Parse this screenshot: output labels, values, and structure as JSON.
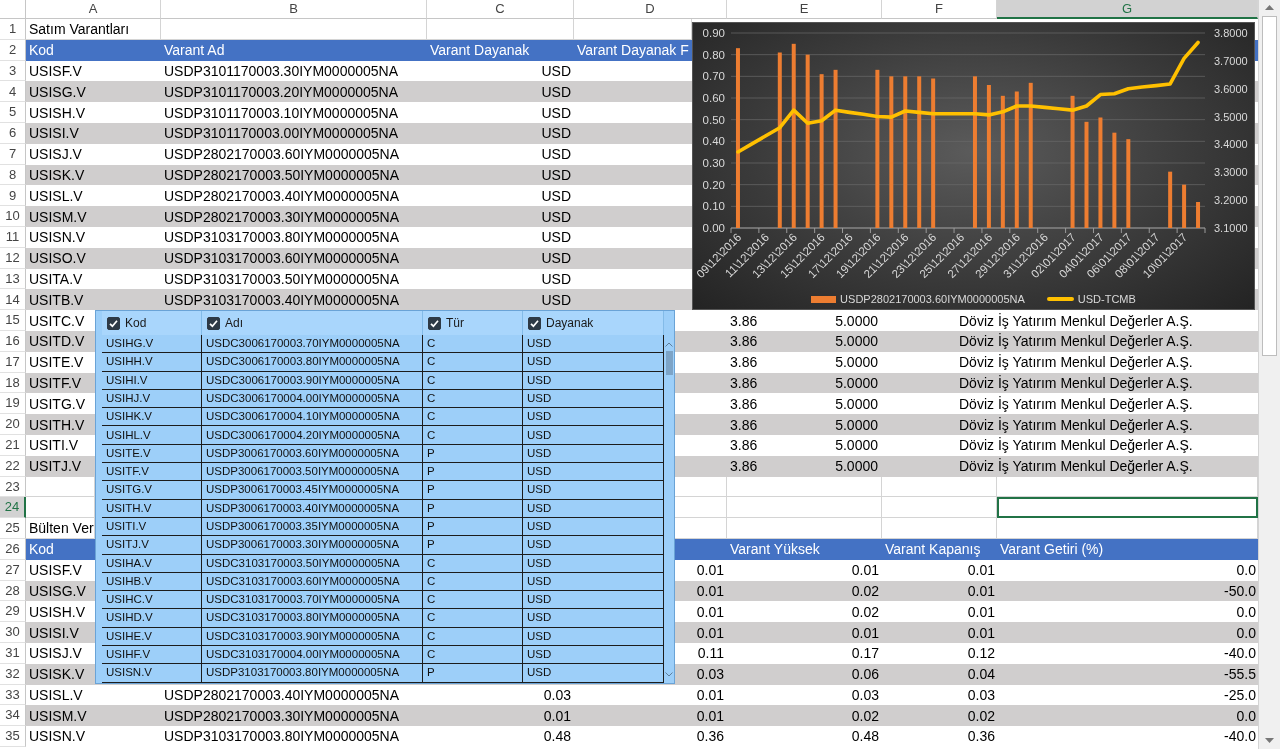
{
  "column_headers": [
    {
      "label": "A",
      "selected": false
    },
    {
      "label": "B",
      "selected": false
    },
    {
      "label": "C",
      "selected": false
    },
    {
      "label": "D",
      "selected": false
    },
    {
      "label": "E",
      "selected": false
    },
    {
      "label": "F",
      "selected": false
    },
    {
      "label": "G",
      "selected": true
    }
  ],
  "row_headers": [
    {
      "label": "1",
      "selected": false
    },
    {
      "label": "2",
      "selected": false
    },
    {
      "label": "3",
      "selected": false
    },
    {
      "label": "4",
      "selected": false
    },
    {
      "label": "5",
      "selected": false
    },
    {
      "label": "6",
      "selected": false
    },
    {
      "label": "7",
      "selected": false
    },
    {
      "label": "8",
      "selected": false
    },
    {
      "label": "9",
      "selected": false
    },
    {
      "label": "10",
      "selected": false
    },
    {
      "label": "11",
      "selected": false
    },
    {
      "label": "12",
      "selected": false
    },
    {
      "label": "13",
      "selected": false
    },
    {
      "label": "14",
      "selected": false
    },
    {
      "label": "15",
      "selected": false
    },
    {
      "label": "16",
      "selected": false
    },
    {
      "label": "17",
      "selected": false
    },
    {
      "label": "18",
      "selected": false
    },
    {
      "label": "19",
      "selected": false
    },
    {
      "label": "20",
      "selected": false
    },
    {
      "label": "21",
      "selected": false
    },
    {
      "label": "22",
      "selected": false
    },
    {
      "label": "23",
      "selected": false
    },
    {
      "label": "24",
      "selected": true
    },
    {
      "label": "25",
      "selected": false
    },
    {
      "label": "26",
      "selected": false
    },
    {
      "label": "27",
      "selected": false
    },
    {
      "label": "28",
      "selected": false
    },
    {
      "label": "29",
      "selected": false
    },
    {
      "label": "30",
      "selected": false
    },
    {
      "label": "31",
      "selected": false
    },
    {
      "label": "32",
      "selected": false
    },
    {
      "label": "33",
      "selected": false
    },
    {
      "label": "34",
      "selected": false
    },
    {
      "label": "35",
      "selected": false
    }
  ],
  "warrants": {
    "title": "Satım Varantları",
    "columns": {
      "kod": "Kod",
      "varant_ad": "Varant Ad",
      "varant_dayanak": "Varant Dayanak",
      "column_4": "Varant Dayanak F"
    },
    "rows": [
      {
        "kod": "USISF.V",
        "varant_ad": "USDP3101170003.30IYM0000005NA",
        "varant_dayanak": "USD"
      },
      {
        "kod": "USISG.V",
        "varant_ad": "USDP3101170003.20IYM0000005NA",
        "varant_dayanak": "USD"
      },
      {
        "kod": "USISH.V",
        "varant_ad": "USDP3101170003.10IYM0000005NA",
        "varant_dayanak": "USD"
      },
      {
        "kod": "USISI.V",
        "varant_ad": "USDP3101170003.00IYM0000005NA",
        "varant_dayanak": "USD"
      },
      {
        "kod": "USISJ.V",
        "varant_ad": "USDP2802170003.60IYM0000005NA",
        "varant_dayanak": "USD"
      },
      {
        "kod": "USISK.V",
        "varant_ad": "USDP2802170003.50IYM0000005NA",
        "varant_dayanak": "USD"
      },
      {
        "kod": "USISL.V",
        "varant_ad": "USDP2802170003.40IYM0000005NA",
        "varant_dayanak": "USD"
      },
      {
        "kod": "USISM.V",
        "varant_ad": "USDP2802170003.30IYM0000005NA",
        "varant_dayanak": "USD"
      },
      {
        "kod": "USISN.V",
        "varant_ad": "USDP3103170003.80IYM0000005NA",
        "varant_dayanak": "USD"
      },
      {
        "kod": "USISO.V",
        "varant_ad": "USDP3103170003.60IYM0000005NA",
        "varant_dayanak": "USD"
      },
      {
        "kod": "USITA.V",
        "varant_ad": "USDP3103170003.50IYM0000005NA",
        "varant_dayanak": "USD"
      },
      {
        "kod": "USITB.V",
        "varant_ad": "USDP3103170003.40IYM0000005NA",
        "varant_dayanak": "USD"
      },
      {
        "kod": "USITC.V",
        "column_5": "3.86",
        "column_6": "5.0000",
        "column_7": "Döviz İş Yatırım Menkul Değerler A.Ş."
      },
      {
        "kod": "USITD.V",
        "column_5": "3.86",
        "column_6": "5.0000",
        "column_7": "Döviz İş Yatırım Menkul Değerler A.Ş."
      },
      {
        "kod": "USITE.V",
        "column_5": "3.86",
        "column_6": "5.0000",
        "column_7": "Döviz İş Yatırım Menkul Değerler A.Ş."
      },
      {
        "kod": "USITF.V",
        "column_5": "3.86",
        "column_6": "5.0000",
        "column_7": "Döviz İş Yatırım Menkul Değerler A.Ş."
      },
      {
        "kod": "USITG.V",
        "column_5": "3.86",
        "column_6": "5.0000",
        "column_7": "Döviz İş Yatırım Menkul Değerler A.Ş."
      },
      {
        "kod": "USITH.V",
        "column_5": "3.86",
        "column_6": "5.0000",
        "column_7": "Döviz İş Yatırım Menkul Değerler A.Ş."
      },
      {
        "kod": "USITI.V",
        "column_5": "3.86",
        "column_6": "5.0000",
        "column_7": "Döviz İş Yatırım Menkul Değerler A.Ş."
      },
      {
        "kod": "USITJ.V",
        "column_5": "3.86",
        "column_6": "5.0000",
        "column_7": "Döviz İş Yatırım Menkul Değerler A.Ş."
      }
    ]
  },
  "bulletin": {
    "title": "Bülten Ver",
    "columns": {
      "kod": "Kod",
      "varant_yuksek": "Varant Yüksek",
      "varant_kapanis": "Varant Kapanış",
      "varant_getiri": "Varant Getiri (%)"
    },
    "rows": [
      {
        "kod": "USISF.V",
        "column_4": "0.01",
        "varant_yuksek": "0.01",
        "varant_kapanis": "0.01",
        "varant_getiri": "0.0"
      },
      {
        "kod": "USISG.V",
        "column_4": "0.01",
        "varant_yuksek": "0.02",
        "varant_kapanis": "0.01",
        "varant_getiri": "-50.0"
      },
      {
        "kod": "USISH.V",
        "column_4": "0.01",
        "varant_yuksek": "0.02",
        "varant_kapanis": "0.01",
        "varant_getiri": "0.0"
      },
      {
        "kod": "USISI.V",
        "column_4": "0.01",
        "varant_yuksek": "0.01",
        "varant_kapanis": "0.01",
        "varant_getiri": "0.0"
      },
      {
        "kod": "USISJ.V",
        "column_4": "0.11",
        "varant_yuksek": "0.17",
        "varant_kapanis": "0.12",
        "varant_getiri": "-40.0"
      },
      {
        "kod": "USISK.V",
        "column_4": "0.03",
        "varant_yuksek": "0.06",
        "varant_kapanis": "0.04",
        "varant_getiri": "-55.5"
      },
      {
        "kod": "USISL.V",
        "column_2": "USDP2802170003.40IYM0000005NA",
        "column_3": "0.03",
        "column_4": "0.01",
        "varant_yuksek": "0.03",
        "varant_kapanis": "0.03",
        "varant_getiri": "-25.0"
      },
      {
        "kod": "USISM.V",
        "column_2": "USDP2802170003.30IYM0000005NA",
        "column_3": "0.01",
        "column_4": "0.01",
        "varant_yuksek": "0.02",
        "varant_kapanis": "0.02",
        "varant_getiri": "0.0"
      },
      {
        "kod": "USISN.V",
        "column_2": "USDP3103170003.80IYM0000005NA",
        "column_3": "0.48",
        "column_4": "0.36",
        "varant_yuksek": "0.48",
        "varant_kapanis": "0.36",
        "varant_getiri": "-40.0"
      }
    ]
  },
  "chart": {
    "chart_data": {
      "type": "bar",
      "categories": [
        "09\\12\\2016",
        null,
        "11\\12\\2016",
        null,
        "13\\12\\2016",
        null,
        "15\\12\\2016",
        null,
        "17\\12\\2016",
        null,
        "19\\12\\2016",
        null,
        "21\\12\\2016",
        null,
        "23\\12\\2016",
        null,
        "25\\12\\2016",
        null,
        "27\\12\\2016",
        null,
        "29\\12\\2016",
        null,
        "31\\12\\2016",
        null,
        "02\\01\\2017",
        null,
        "04\\01\\2017",
        null,
        "06\\01\\2017",
        null,
        "08\\01\\2017",
        null,
        "10\\01\\2017",
        null
      ],
      "ylim": [
        0,
        0.9
      ],
      "yticks": [
        {
          "value": 0,
          "label": "0.00"
        },
        {
          "value": 0.1,
          "label": "0.10"
        },
        {
          "value": 0.2,
          "label": "0.20"
        },
        {
          "value": 0.3,
          "label": "0.30"
        },
        {
          "value": 0.4,
          "label": "0.40"
        },
        {
          "value": 0.5,
          "label": "0.50"
        },
        {
          "value": 0.6,
          "label": "0.60"
        },
        {
          "value": 0.7,
          "label": "0.70"
        },
        {
          "value": 0.8,
          "label": "0.80"
        },
        {
          "value": 0.9,
          "label": "0.90"
        }
      ],
      "y2lim": [
        3.1,
        3.8
      ],
      "y2ticks": [
        {
          "value": 3.1,
          "label": "3.1000"
        },
        {
          "value": 3.2,
          "label": "3.2000"
        },
        {
          "value": 3.3,
          "label": "3.3000"
        },
        {
          "value": 3.4,
          "label": "3.4000"
        },
        {
          "value": 3.5,
          "label": "3.5000"
        },
        {
          "value": 3.6,
          "label": "3.6000"
        },
        {
          "value": 3.7,
          "label": "3.7000"
        },
        {
          "value": 3.8,
          "label": "3.8000"
        }
      ],
      "grid": true,
      "legend": "bottom",
      "series": [
        {
          "name": "USDP2802170003.60IYM0000005NA",
          "color": "#ed7d31",
          "type": "bar",
          "values": [
            0.83,
            null,
            null,
            0.81,
            0.85,
            0.8,
            0.71,
            0.73,
            null,
            null,
            0.73,
            0.7,
            0.7,
            0.7,
            0.69,
            null,
            null,
            0.7,
            0.66,
            0.61,
            0.63,
            0.67,
            null,
            null,
            0.61,
            0.49,
            0.51,
            0.44,
            0.41,
            null,
            null,
            0.26,
            0.2,
            0.12
          ]
        },
        {
          "name": "USD-TCMB",
          "color": "#ffc000",
          "type": "line",
          "axis": "y2",
          "values": [
            3.373,
            3.402,
            3.431,
            3.46,
            3.523,
            3.476,
            3.485,
            3.523,
            3.515,
            3.508,
            3.5,
            3.498,
            3.52,
            3.515,
            3.51,
            3.51,
            3.51,
            3.51,
            3.506,
            3.517,
            3.538,
            3.538,
            3.533,
            3.528,
            3.523,
            3.538,
            3.579,
            3.582,
            3.6,
            3.606,
            3.611,
            3.617,
            3.709,
            3.766
          ]
        }
      ]
    }
  },
  "popup": {
    "columns": [
      {
        "label": "Kod",
        "checked": true
      },
      {
        "label": "Adı",
        "checked": true
      },
      {
        "label": "Tür",
        "checked": true
      },
      {
        "label": "Dayanak",
        "checked": true
      }
    ],
    "rows": [
      {
        "kod": "USIHG.V",
        "adi": "USDC3006170003.70IYM0000005NA",
        "tur": "C",
        "dayanak": "USD"
      },
      {
        "kod": "USIHH.V",
        "adi": "USDC3006170003.80IYM0000005NA",
        "tur": "C",
        "dayanak": "USD"
      },
      {
        "kod": "USIHI.V",
        "adi": "USDC3006170003.90IYM0000005NA",
        "tur": "C",
        "dayanak": "USD"
      },
      {
        "kod": "USIHJ.V",
        "adi": "USDC3006170004.00IYM0000005NA",
        "tur": "C",
        "dayanak": "USD"
      },
      {
        "kod": "USIHK.V",
        "adi": "USDC3006170004.10IYM0000005NA",
        "tur": "C",
        "dayanak": "USD"
      },
      {
        "kod": "USIHL.V",
        "adi": "USDC3006170004.20IYM0000005NA",
        "tur": "C",
        "dayanak": "USD"
      },
      {
        "kod": "USITE.V",
        "adi": "USDP3006170003.60IYM0000005NA",
        "tur": "P",
        "dayanak": "USD"
      },
      {
        "kod": "USITF.V",
        "adi": "USDP3006170003.50IYM0000005NA",
        "tur": "P",
        "dayanak": "USD"
      },
      {
        "kod": "USITG.V",
        "adi": "USDP3006170003.45IYM0000005NA",
        "tur": "P",
        "dayanak": "USD"
      },
      {
        "kod": "USITH.V",
        "adi": "USDP3006170003.40IYM0000005NA",
        "tur": "P",
        "dayanak": "USD"
      },
      {
        "kod": "USITI.V",
        "adi": "USDP3006170003.35IYM0000005NA",
        "tur": "P",
        "dayanak": "USD"
      },
      {
        "kod": "USITJ.V",
        "adi": "USDP3006170003.30IYM0000005NA",
        "tur": "P",
        "dayanak": "USD"
      },
      {
        "kod": "USIHA.V",
        "adi": "USDC3103170003.50IYM0000005NA",
        "tur": "C",
        "dayanak": "USD"
      },
      {
        "kod": "USIHB.V",
        "adi": "USDC3103170003.60IYM0000005NA",
        "tur": "C",
        "dayanak": "USD"
      },
      {
        "kod": "USIHC.V",
        "adi": "USDC3103170003.70IYM0000005NA",
        "tur": "C",
        "dayanak": "USD"
      },
      {
        "kod": "USIHD.V",
        "adi": "USDC3103170003.80IYM0000005NA",
        "tur": "C",
        "dayanak": "USD"
      },
      {
        "kod": "USIHE.V",
        "adi": "USDC3103170003.90IYM0000005NA",
        "tur": "C",
        "dayanak": "USD"
      },
      {
        "kod": "USIHF.V",
        "adi": "USDC3103170004.00IYM0000005NA",
        "tur": "C",
        "dayanak": "USD"
      },
      {
        "kod": "USISN.V",
        "adi": "USDP3103170003.80IYM0000005NA",
        "tur": "P",
        "dayanak": "USD"
      }
    ]
  }
}
